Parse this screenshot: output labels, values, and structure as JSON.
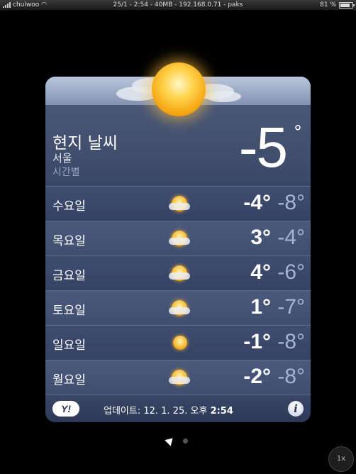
{
  "status_bar": {
    "carrier": "chulwoo",
    "center_text": "25/1 - 2:54 - 40MB - 192.168.0.71 - paks",
    "battery": "81 %",
    "battery_level": 0.81
  },
  "current": {
    "title": "현지 날씨",
    "city": "서울",
    "hourly_label": "시간별",
    "temperature": "-5",
    "degree_symbol": "°",
    "condition_icon": "sun-with-clouds-icon"
  },
  "forecast": [
    {
      "day": "수요일",
      "icon": "sun-cloud-icon",
      "high": "-4°",
      "low": "-8°"
    },
    {
      "day": "목요일",
      "icon": "sun-cloud-icon",
      "high": "3°",
      "low": "-4°"
    },
    {
      "day": "금요일",
      "icon": "sun-cloud-icon",
      "high": "4°",
      "low": "-6°"
    },
    {
      "day": "토요일",
      "icon": "sun-cloud-icon",
      "high": "1°",
      "low": "-7°"
    },
    {
      "day": "일요일",
      "icon": "sun-icon",
      "high": "-1°",
      "low": "-8°"
    },
    {
      "day": "월요일",
      "icon": "sun-cloud-icon",
      "high": "-2°",
      "low": "-8°"
    }
  ],
  "footer": {
    "yahoo_label": "Y!",
    "update_prefix": "업데이트: 12. 1. 25. 오후 ",
    "update_time": "2:54",
    "info_label": "i"
  },
  "zoom_button": "1x"
}
